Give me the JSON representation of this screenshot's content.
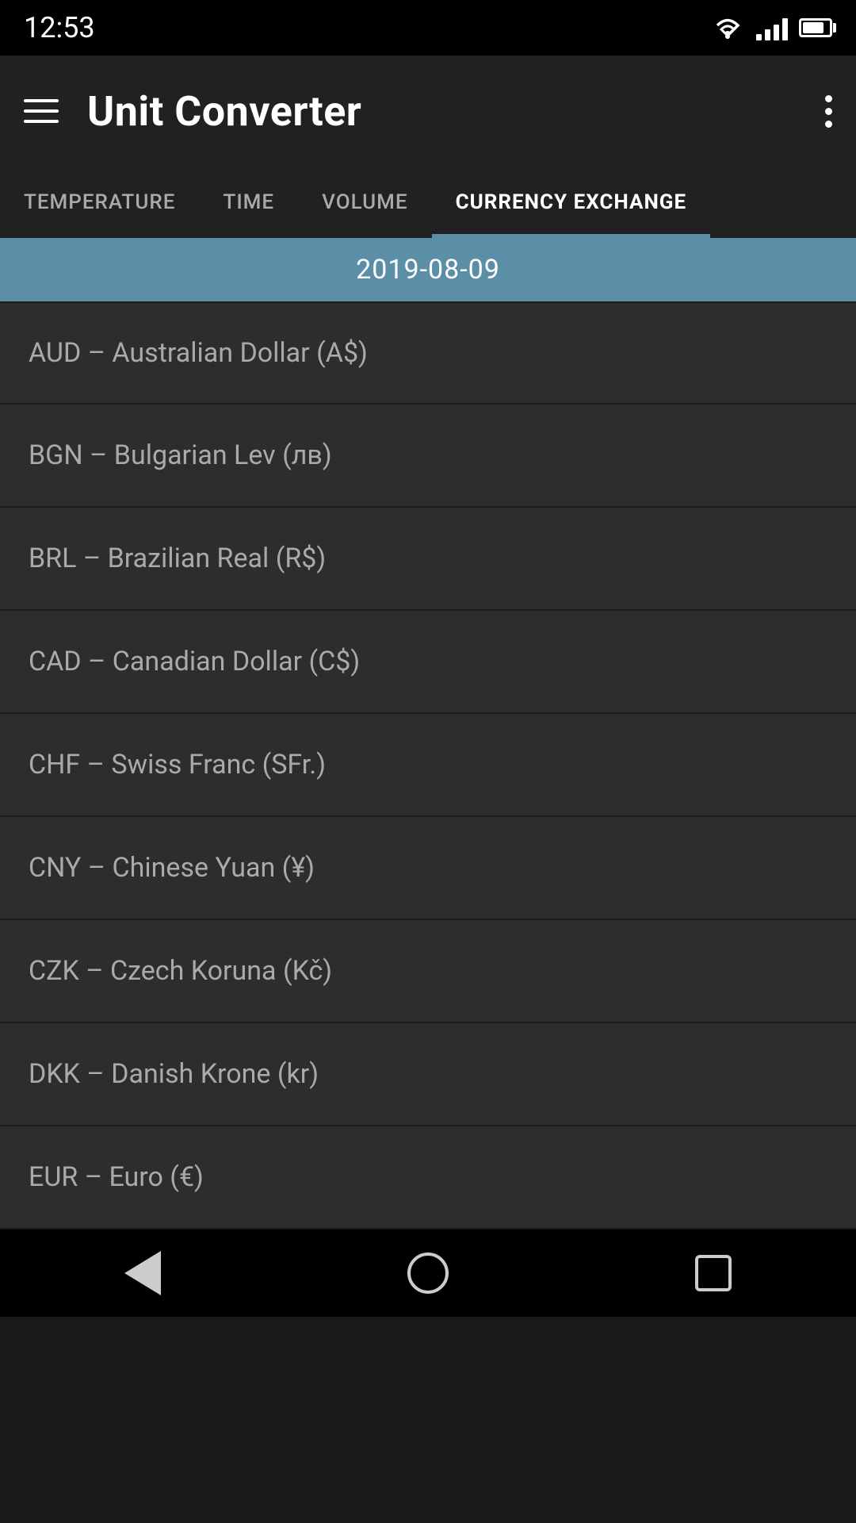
{
  "statusBar": {
    "time": "12:53"
  },
  "appBar": {
    "title": "Unit Converter",
    "menuIcon": "hamburger-icon",
    "moreIcon": "more-icon"
  },
  "tabs": [
    {
      "id": "temperature",
      "label": "TEMPERATURE",
      "active": false
    },
    {
      "id": "time",
      "label": "TIME",
      "active": false
    },
    {
      "id": "volume",
      "label": "VOLUME",
      "active": false
    },
    {
      "id": "currency",
      "label": "CURRENCY EXCHANGE",
      "active": true
    }
  ],
  "dateHeader": {
    "date": "2019-08-09"
  },
  "currencies": [
    {
      "id": "aud",
      "label": "AUD – Australian Dollar (A$)"
    },
    {
      "id": "bgn",
      "label": "BGN – Bulgarian Lev (лв)"
    },
    {
      "id": "brl",
      "label": "BRL – Brazilian Real (R$)"
    },
    {
      "id": "cad",
      "label": "CAD – Canadian Dollar (C$)"
    },
    {
      "id": "chf",
      "label": "CHF – Swiss Franc (SFr.)"
    },
    {
      "id": "cny",
      "label": "CNY – Chinese Yuan (¥)"
    },
    {
      "id": "czk",
      "label": "CZK – Czech Koruna (Kč)"
    },
    {
      "id": "dkk",
      "label": "DKK – Danish Krone (kr)"
    },
    {
      "id": "eur",
      "label": "EUR – Euro (€)"
    }
  ],
  "bottomNav": {
    "backLabel": "back",
    "homeLabel": "home",
    "recentLabel": "recent"
  }
}
